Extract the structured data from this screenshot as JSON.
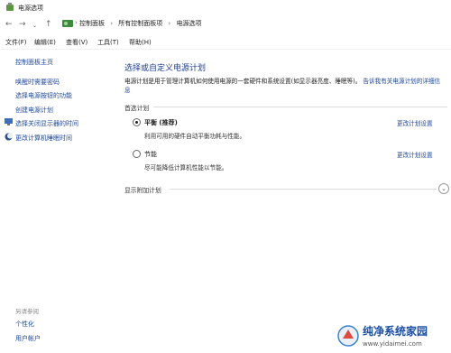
{
  "window": {
    "title": "电源选项"
  },
  "address": {
    "breadcrumbs": [
      "控制面板",
      "所有控制面板项",
      "电源选项"
    ]
  },
  "menu": [
    "文件(F)",
    "编辑(E)",
    "查看(V)",
    "工具(T)",
    "帮助(H)"
  ],
  "sidebar": {
    "home": "控制面板主页",
    "items": [
      "唤醒时需要密码",
      "选择电源按钮的功能",
      "创建电源计划",
      "选择关闭显示器的时间",
      "更改计算机睡眠时间"
    ],
    "see_also_title": "另请参阅",
    "see_also": [
      "个性化",
      "用户帐户"
    ]
  },
  "main": {
    "title": "选择或自定义电源计划",
    "intro_text": "电源计划是用于管理计算机如何使用电源的一套硬件和系统设置(如显示器亮度、睡眠等)。",
    "intro_link": "告诉我有关电源计划的详细信息",
    "section_title": "首选计划",
    "plans": [
      {
        "name": "平衡 (推荐)",
        "desc": "利用可用的硬件自动平衡功耗与性能。",
        "selected": true,
        "change": "更改计划设置"
      },
      {
        "name": "节能",
        "desc": "尽可能降低计算机性能以节能。",
        "selected": false,
        "change": "更改计划设置"
      }
    ],
    "more_plans": "显示附加计划"
  },
  "watermark": {
    "line1": "纯净系统家园",
    "line2": "www.yidaimei.com"
  },
  "colors": {
    "link": "#1f49a0",
    "heading": "#1e3f91"
  }
}
